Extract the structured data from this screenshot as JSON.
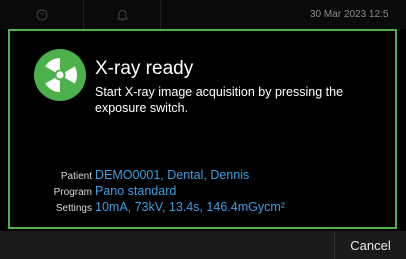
{
  "topbar": {
    "date_time": "30 Mar 2023 12:5"
  },
  "dialog": {
    "icon": "radiation-icon",
    "title": "X-ray ready",
    "message": "Start X-ray image acquisition by pressing the exposure switch.",
    "fields": [
      {
        "label": "Patient",
        "value": "DEMO0001, Dental, Dennis"
      },
      {
        "label": "Program",
        "value": "Pano standard"
      },
      {
        "label": "Settings",
        "value": "10mA, 73kV, 13.4s, 146.4mGycm²"
      }
    ]
  },
  "bottombar": {
    "cancel_label": "Cancel"
  },
  "colors": {
    "accent_green": "#4cb14a",
    "value_blue": "#3b9fe0"
  }
}
